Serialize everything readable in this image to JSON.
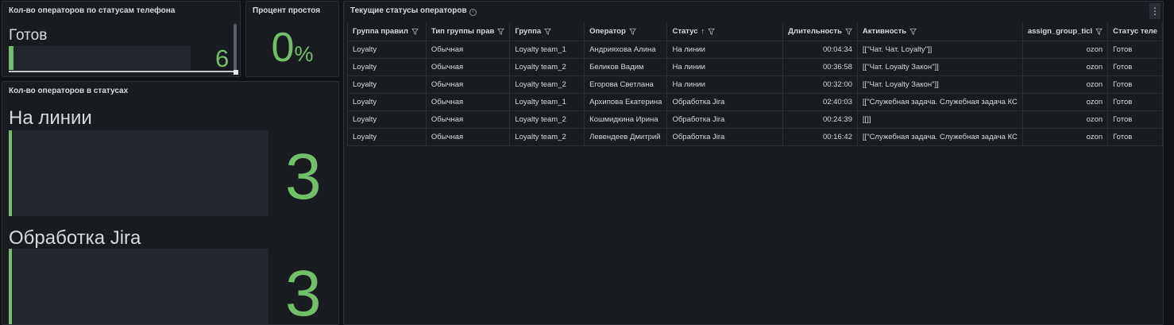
{
  "panels": {
    "phone_status": {
      "title": "Кол-во операторов по статусам телефона",
      "label": "Готов",
      "value": "6",
      "fill_fraction": 0.02
    },
    "idle_percent": {
      "title": "Процент простоя",
      "value": "0",
      "unit": "%"
    },
    "status_counts": {
      "title": "Кол-во операторов в статусах",
      "items": [
        {
          "label": "На линии",
          "value": "3"
        },
        {
          "label": "Обработка Jira",
          "value": "3"
        }
      ]
    },
    "current_status": {
      "title": "Текущие статусы операторов",
      "info_icon": "info-icon",
      "menu_icon": "⋮",
      "columns": [
        {
          "label": "Группа правил",
          "filter": true
        },
        {
          "label": "Тип группы прав",
          "filter": true
        },
        {
          "label": "Группа",
          "filter": true
        },
        {
          "label": "Оператор",
          "filter": true
        },
        {
          "label": "Статус",
          "filter": true,
          "sort": "↑"
        },
        {
          "label": "Длительность",
          "filter": true
        },
        {
          "label": "Активность",
          "filter": true
        },
        {
          "label": "assign_group_ticl",
          "filter": true
        },
        {
          "label": "Статус теле",
          "filter": false
        }
      ],
      "rows": [
        [
          "Loyalty",
          "Обычная",
          "Loyalty team_1",
          "Андрияхова Алина",
          "На линии",
          "00:04:34",
          "[[\"Чат. Чат. Loyalty\"]]",
          "ozon",
          "Готов"
        ],
        [
          "Loyalty",
          "Обычная",
          "Loyalty team_2",
          "Беликов Вадим",
          "На линии",
          "00:36:58",
          "[[\"Чат. Loyalty Закон\"]]",
          "ozon",
          "Готов"
        ],
        [
          "Loyalty",
          "Обычная",
          "Loyalty team_2",
          "Егорова Светлана",
          "На линии",
          "00:32:00",
          "[[\"Чат. Loyalty Закон\"]]",
          "ozon",
          "Готов"
        ],
        [
          "Loyalty",
          "Обычная",
          "Loyalty team_1",
          "Архипова Екатерина",
          "Обработка Jira",
          "02:40:03",
          "[[\"Служебная задача. Служебная задача КС",
          "ozon",
          "Готов"
        ],
        [
          "Loyalty",
          "Обычная",
          "Loyalty team_2",
          "Кошмидкина Ирина",
          "Обработка Jira",
          "00:24:39",
          "[[]]",
          "ozon",
          "Готов"
        ],
        [
          "Loyalty",
          "Обычная",
          "Loyalty team_2",
          "Левендеев Дмитрий",
          "Обработка Jira",
          "00:16:42",
          "[[\"Служебная задача. Служебная задача КС",
          "ozon",
          "Готов"
        ]
      ]
    }
  },
  "colors": {
    "background": "#111217",
    "panel": "#181b1f",
    "accent_green": "#73bf69",
    "text": "#d8d9e0"
  }
}
